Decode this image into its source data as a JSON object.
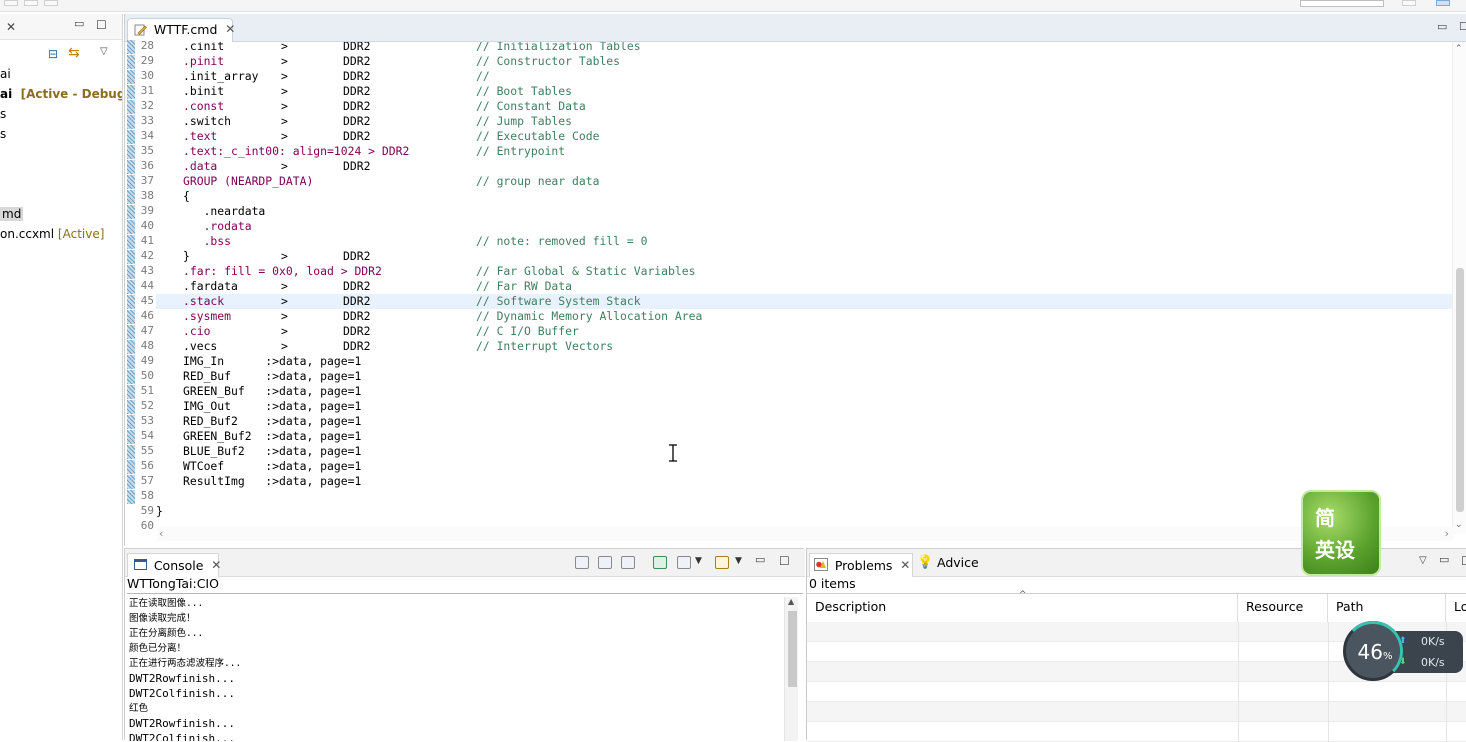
{
  "editor": {
    "tab_label": "WTTF.cmd",
    "lines": [
      {
        "n": "28",
        "a": ".cinit",
        "b": ">",
        "c": "DDR2",
        "d": "// Initialization Tables",
        "kw": false
      },
      {
        "n": "29",
        "a": ".pinit",
        "b": ">",
        "c": "DDR2",
        "d": "// Constructor Tables",
        "kw": true
      },
      {
        "n": "30",
        "a": ".init_array",
        "b": ">",
        "c": "DDR2",
        "d": "//",
        "kw": false
      },
      {
        "n": "31",
        "a": ".binit",
        "b": ">",
        "c": "DDR2",
        "d": "// Boot Tables",
        "kw": false
      },
      {
        "n": "32",
        "a": ".const",
        "b": ">",
        "c": "DDR2",
        "d": "// Constant Data",
        "kw": true
      },
      {
        "n": "33",
        "a": ".switch",
        "b": ">",
        "c": "DDR2",
        "d": "// Jump Tables",
        "kw": false
      },
      {
        "n": "34",
        "a": ".text",
        "b": ">",
        "c": "DDR2",
        "d": "// Executable Code",
        "kw": true
      },
      {
        "n": "35",
        "a": ".text:_c_int00: align=1024 > DDR2",
        "b": "",
        "c": "",
        "d": "// Entrypoint",
        "kw": true
      },
      {
        "n": "36",
        "a": ".data",
        "b": ">",
        "c": "DDR2",
        "d": "",
        "kw": true
      },
      {
        "n": "37",
        "a": "GROUP (NEARDP_DATA)",
        "b": "",
        "c": "",
        "d": "// group near data",
        "kw": true
      },
      {
        "n": "38",
        "a": "{",
        "b": "",
        "c": "",
        "d": "",
        "kw": false
      },
      {
        "n": "39",
        "a": "   .neardata",
        "b": "",
        "c": "",
        "d": "",
        "kw": false
      },
      {
        "n": "40",
        "a": "   .rodata",
        "b": "",
        "c": "",
        "d": "",
        "kw": true
      },
      {
        "n": "41",
        "a": "   .bss",
        "b": "",
        "c": "",
        "d": "// note: removed fill = 0",
        "kw": true
      },
      {
        "n": "42",
        "a": "}",
        "b": ">",
        "c": "DDR2",
        "d": "",
        "kw": false
      },
      {
        "n": "43",
        "a": ".far: fill = 0x0, load > DDR2",
        "b": "",
        "c": "",
        "d": "// Far Global & Static Variables",
        "kw": true
      },
      {
        "n": "44",
        "a": ".fardata",
        "b": ">",
        "c": "DDR2",
        "d": "// Far RW Data",
        "kw": false
      },
      {
        "n": "45",
        "a": ".stack",
        "b": ">",
        "c": "DDR2",
        "d": "// Software System Stack",
        "kw": true
      },
      {
        "n": "46",
        "a": ".sysmem",
        "b": ">",
        "c": "DDR2",
        "d": "// Dynamic Memory Allocation Area",
        "kw": true
      },
      {
        "n": "47",
        "a": ".cio",
        "b": ">",
        "c": "DDR2",
        "d": "// C I/O Buffer",
        "kw": true
      },
      {
        "n": "48",
        "a": ".vecs",
        "b": ">",
        "c": "DDR2",
        "d": "// Interrupt Vectors",
        "kw": false
      },
      {
        "n": "49",
        "a": "IMG_In      :>data, page=1",
        "b": "",
        "c": "",
        "d": "",
        "kw": false
      },
      {
        "n": "50",
        "a": "RED_Buf     :>data, page=1",
        "b": "",
        "c": "",
        "d": "",
        "kw": false
      },
      {
        "n": "51",
        "a": "GREEN_Buf   :>data, page=1",
        "b": "",
        "c": "",
        "d": "",
        "kw": false
      },
      {
        "n": "52",
        "a": "IMG_Out     :>data, page=1",
        "b": "",
        "c": "",
        "d": "",
        "kw": false
      },
      {
        "n": "53",
        "a": "RED_Buf2    :>data, page=1",
        "b": "",
        "c": "",
        "d": "",
        "kw": false
      },
      {
        "n": "54",
        "a": "GREEN_Buf2  :>data, page=1",
        "b": "",
        "c": "",
        "d": "",
        "kw": false
      },
      {
        "n": "55",
        "a": "BLUE_Buf2   :>data, page=1",
        "b": "",
        "c": "",
        "d": "",
        "kw": false
      },
      {
        "n": "56",
        "a": "WTCoef      :>data, page=1",
        "b": "",
        "c": "",
        "d": "",
        "kw": false
      },
      {
        "n": "57",
        "a": "ResultImg   :>data, page=1",
        "b": "",
        "c": "",
        "d": "",
        "kw": false
      },
      {
        "n": "58",
        "a": "",
        "b": "",
        "c": "",
        "d": "",
        "kw": false
      },
      {
        "n": "59",
        "a": "}",
        "b": "",
        "c": "",
        "d": "",
        "kw": false,
        "outdent": true
      },
      {
        "n": "60",
        "a": "",
        "b": "",
        "c": "",
        "d": "",
        "kw": false
      }
    ],
    "highlighted_line": "45"
  },
  "left_panel": {
    "rows": [
      {
        "text": "ai",
        "style": "normal"
      },
      {
        "text": "ai",
        "style": "bold",
        "badge": "[Active - Debug]"
      },
      {
        "text": "s",
        "style": "normal"
      },
      {
        "text": "s",
        "style": "normal"
      },
      {
        "text": "md",
        "style": "selected"
      },
      {
        "text": "on.ccxml",
        "style": "normal",
        "badge": "[Active]"
      }
    ]
  },
  "console": {
    "tab_label": "Console",
    "name": "WTTongTai:CIO",
    "output": [
      "正在读取图像...",
      "图像读取完成！",
      "正在分离颜色...",
      "颜色已分离！",
      "正在进行两态滤波程序...",
      "DWT2Rowfinish...",
      "DWT2Colfinish...",
      "红色",
      "DWT2Rowfinish...",
      "DWT2Colfinish..."
    ]
  },
  "problems": {
    "tab_label": "Problems",
    "advice_label": "Advice",
    "count_text": "0 items",
    "columns": [
      "Description",
      "Resource",
      "Path",
      "Lo"
    ]
  },
  "overlays": {
    "logo_chars": [
      "简",
      "英设"
    ],
    "cpu_percent": "46",
    "percent_sign": "%",
    "upload_speed": "0K/s",
    "download_speed": "0K/s"
  }
}
